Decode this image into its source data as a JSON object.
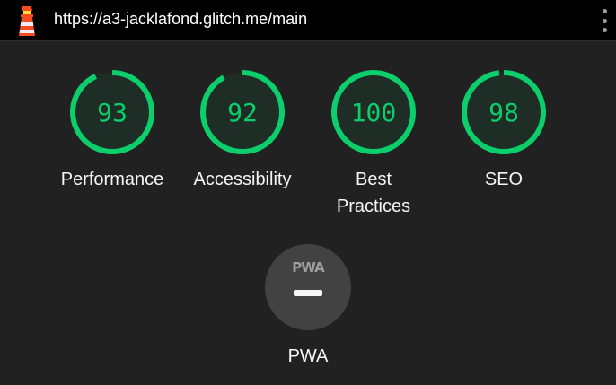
{
  "header": {
    "url": "https://a3-jacklafond.glitch.me/main",
    "logo_icon": "lighthouse-icon",
    "menu_icon": "kebab-menu-icon"
  },
  "colors": {
    "pass": "#0cce6b",
    "gauge_fill": "#1e2e26",
    "pwa_badge": "#424242",
    "background": "#212121"
  },
  "scores": [
    {
      "label": "Performance",
      "value": "93"
    },
    {
      "label": "Accessibility",
      "value": "92"
    },
    {
      "label": "Best Practices",
      "value": "100"
    },
    {
      "label": "SEO",
      "value": "98"
    }
  ],
  "pwa": {
    "badge_text": "PWA",
    "label": "PWA"
  }
}
